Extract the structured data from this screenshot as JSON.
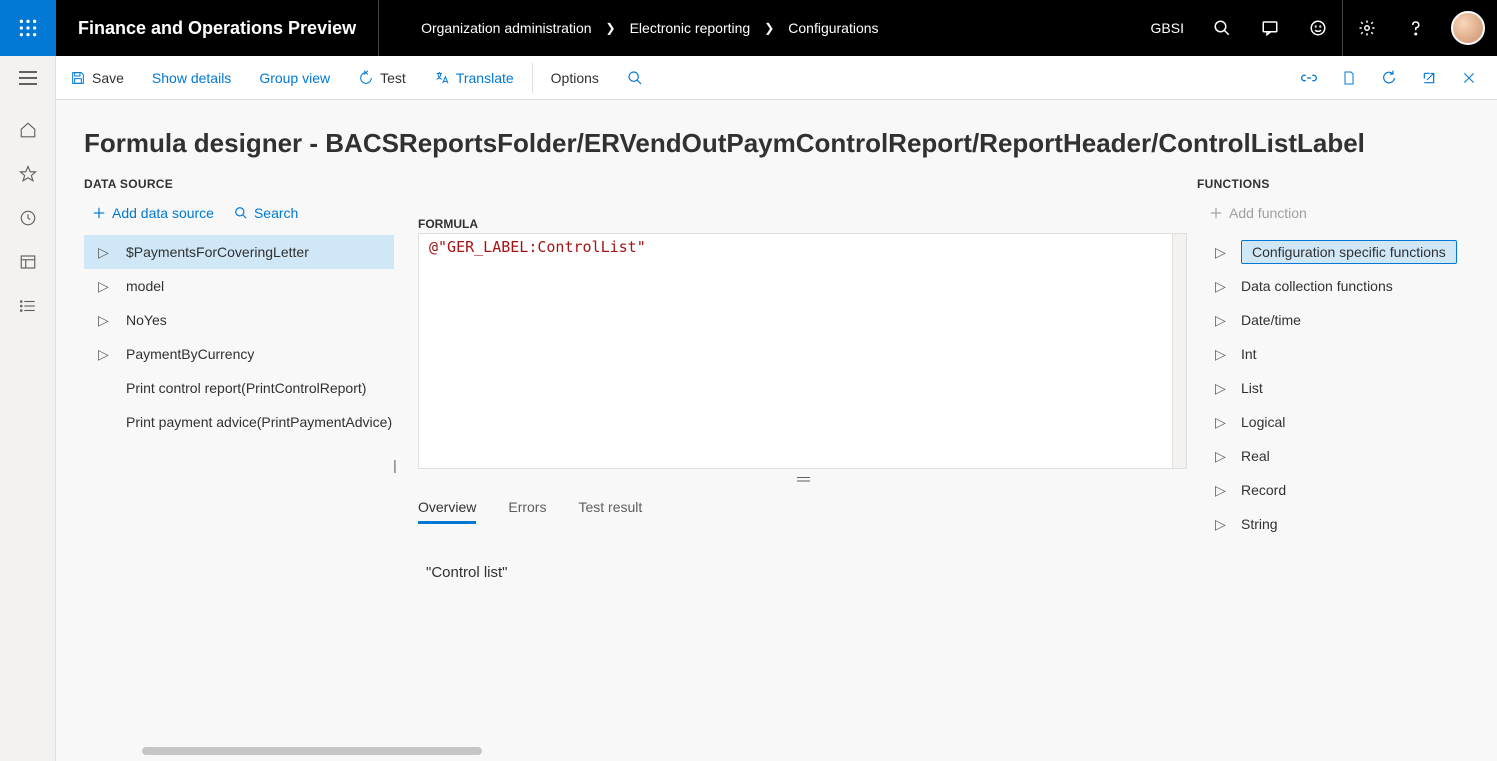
{
  "header": {
    "app_title": "Finance and Operations Preview",
    "company": "GBSI",
    "breadcrumb": [
      "Organization administration",
      "Electronic reporting",
      "Configurations"
    ]
  },
  "toolbar": {
    "save": "Save",
    "show_details": "Show details",
    "group_view": "Group view",
    "test": "Test",
    "translate": "Translate",
    "options": "Options"
  },
  "page": {
    "title": "Formula designer - BACSReportsFolder/ERVendOutPaymControlReport/ReportHeader/ControlListLabel"
  },
  "data_source": {
    "label": "DATA SOURCE",
    "add": "Add data source",
    "search": "Search",
    "items": [
      {
        "expandable": true,
        "label": "$PaymentsForCoveringLetter",
        "selected": true
      },
      {
        "expandable": true,
        "label": "model",
        "selected": false
      },
      {
        "expandable": true,
        "label": "NoYes",
        "selected": false
      },
      {
        "expandable": true,
        "label": "PaymentByCurrency",
        "selected": false
      },
      {
        "expandable": false,
        "label": "Print control report(PrintControlReport)",
        "selected": false
      },
      {
        "expandable": false,
        "label": "Print payment advice(PrintPaymentAdvice)",
        "selected": false
      }
    ]
  },
  "formula": {
    "label": "FORMULA",
    "code": "@\"GER_LABEL:ControlList\""
  },
  "tabs": {
    "items": [
      "Overview",
      "Errors",
      "Test result"
    ],
    "active_index": 0,
    "overview_content": "\"Control list\""
  },
  "functions": {
    "label": "FUNCTIONS",
    "add": "Add function",
    "items": [
      {
        "label": "Configuration specific functions",
        "selected": true
      },
      {
        "label": "Data collection functions",
        "selected": false
      },
      {
        "label": "Date/time",
        "selected": false
      },
      {
        "label": "Int",
        "selected": false
      },
      {
        "label": "List",
        "selected": false
      },
      {
        "label": "Logical",
        "selected": false
      },
      {
        "label": "Real",
        "selected": false
      },
      {
        "label": "Record",
        "selected": false
      },
      {
        "label": "String",
        "selected": false
      }
    ]
  }
}
